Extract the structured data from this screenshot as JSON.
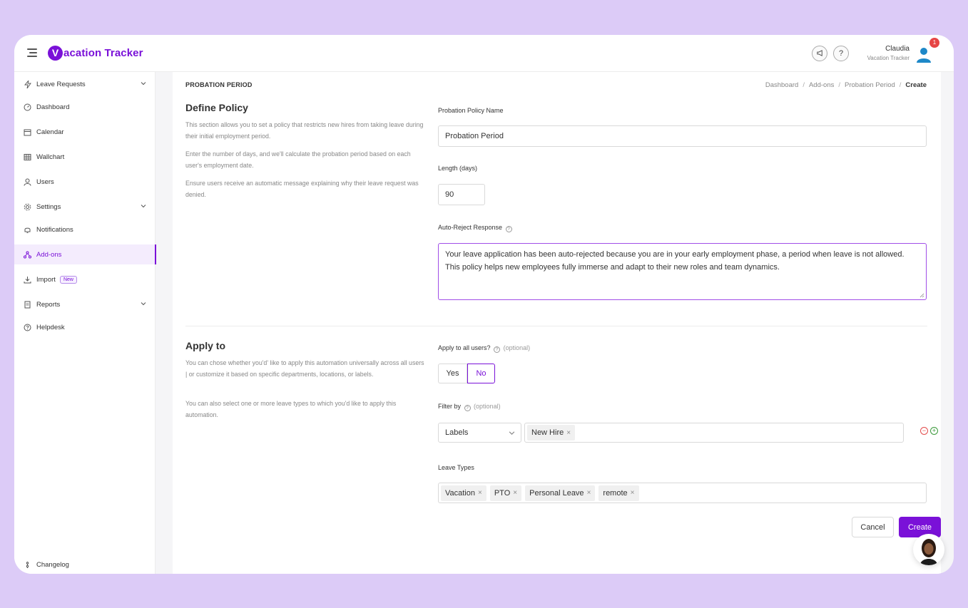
{
  "app": {
    "brand_letter": "V",
    "brand_rest": "acation Tracker"
  },
  "header": {
    "announce_icon": "megaphone-icon",
    "help_label": "?",
    "user_name": "Claudia",
    "user_company": "Vacation Tracker",
    "notification_count": "1"
  },
  "sidebar": {
    "items": [
      {
        "label": "Leave Requests",
        "icon": "bolt-icon"
      },
      {
        "label": "Dashboard",
        "icon": "dashboard-icon"
      },
      {
        "label": "Calendar",
        "icon": "calendar-icon"
      },
      {
        "label": "Wallchart",
        "icon": "grid-icon"
      },
      {
        "label": "Users",
        "icon": "user-icon"
      },
      {
        "label": "Settings",
        "icon": "gear-icon"
      },
      {
        "label": "Notifications",
        "icon": "bell-icon"
      },
      {
        "label": "Add-ons",
        "icon": "addons-icon"
      },
      {
        "label": "Import",
        "icon": "import-icon",
        "tag": "New"
      },
      {
        "label": "Reports",
        "icon": "report-icon"
      },
      {
        "label": "Helpdesk",
        "icon": "help-icon"
      }
    ],
    "footer": "Changelog"
  },
  "page": {
    "label": "PROBATION PERIOD",
    "breadcrumb": [
      "Dashboard",
      "Add-ons",
      "Probation Period",
      "Create"
    ]
  },
  "define": {
    "title": "Define Policy",
    "p1": "This section allows you to set a policy that restricts new hires from taking leave during their initial employment period.",
    "p2": "Enter the number of days, and we'll calculate the probation period based on each user's employment date.",
    "p3": "Ensure users receive an automatic message explaining why their leave request was denied.",
    "name_label": "Probation Policy Name",
    "name_value": "Probation Period",
    "length_label": "Length (days)",
    "length_value": "90",
    "reject_label": "Auto-Reject Response",
    "reject_value": "Your leave application has been auto-rejected because you are in your early employment phase, a period when leave is not allowed. This policy helps new employees fully immerse and adapt to their new roles and team dynamics."
  },
  "apply": {
    "title": "Apply to",
    "p1": "You can chose whether you'd' like to apply this automation universally across all users | or customize it based on specific departments, locations, or labels.",
    "p2": "You can also select one or more leave types to which you'd like to apply this automation.",
    "all_users_label": "Apply to all users?",
    "optional": "(optional)",
    "yes": "Yes",
    "no": "No",
    "filter_label": "Filter by",
    "filter_select": "Labels",
    "filter_tags": [
      "New Hire"
    ],
    "leave_types_label": "Leave Types",
    "leave_types": [
      "Vacation",
      "PTO",
      "Personal Leave",
      "remote"
    ]
  },
  "actions": {
    "cancel": "Cancel",
    "create": "Create"
  },
  "colors": {
    "accent": "#7a11d8",
    "background": "#dccbf7"
  }
}
